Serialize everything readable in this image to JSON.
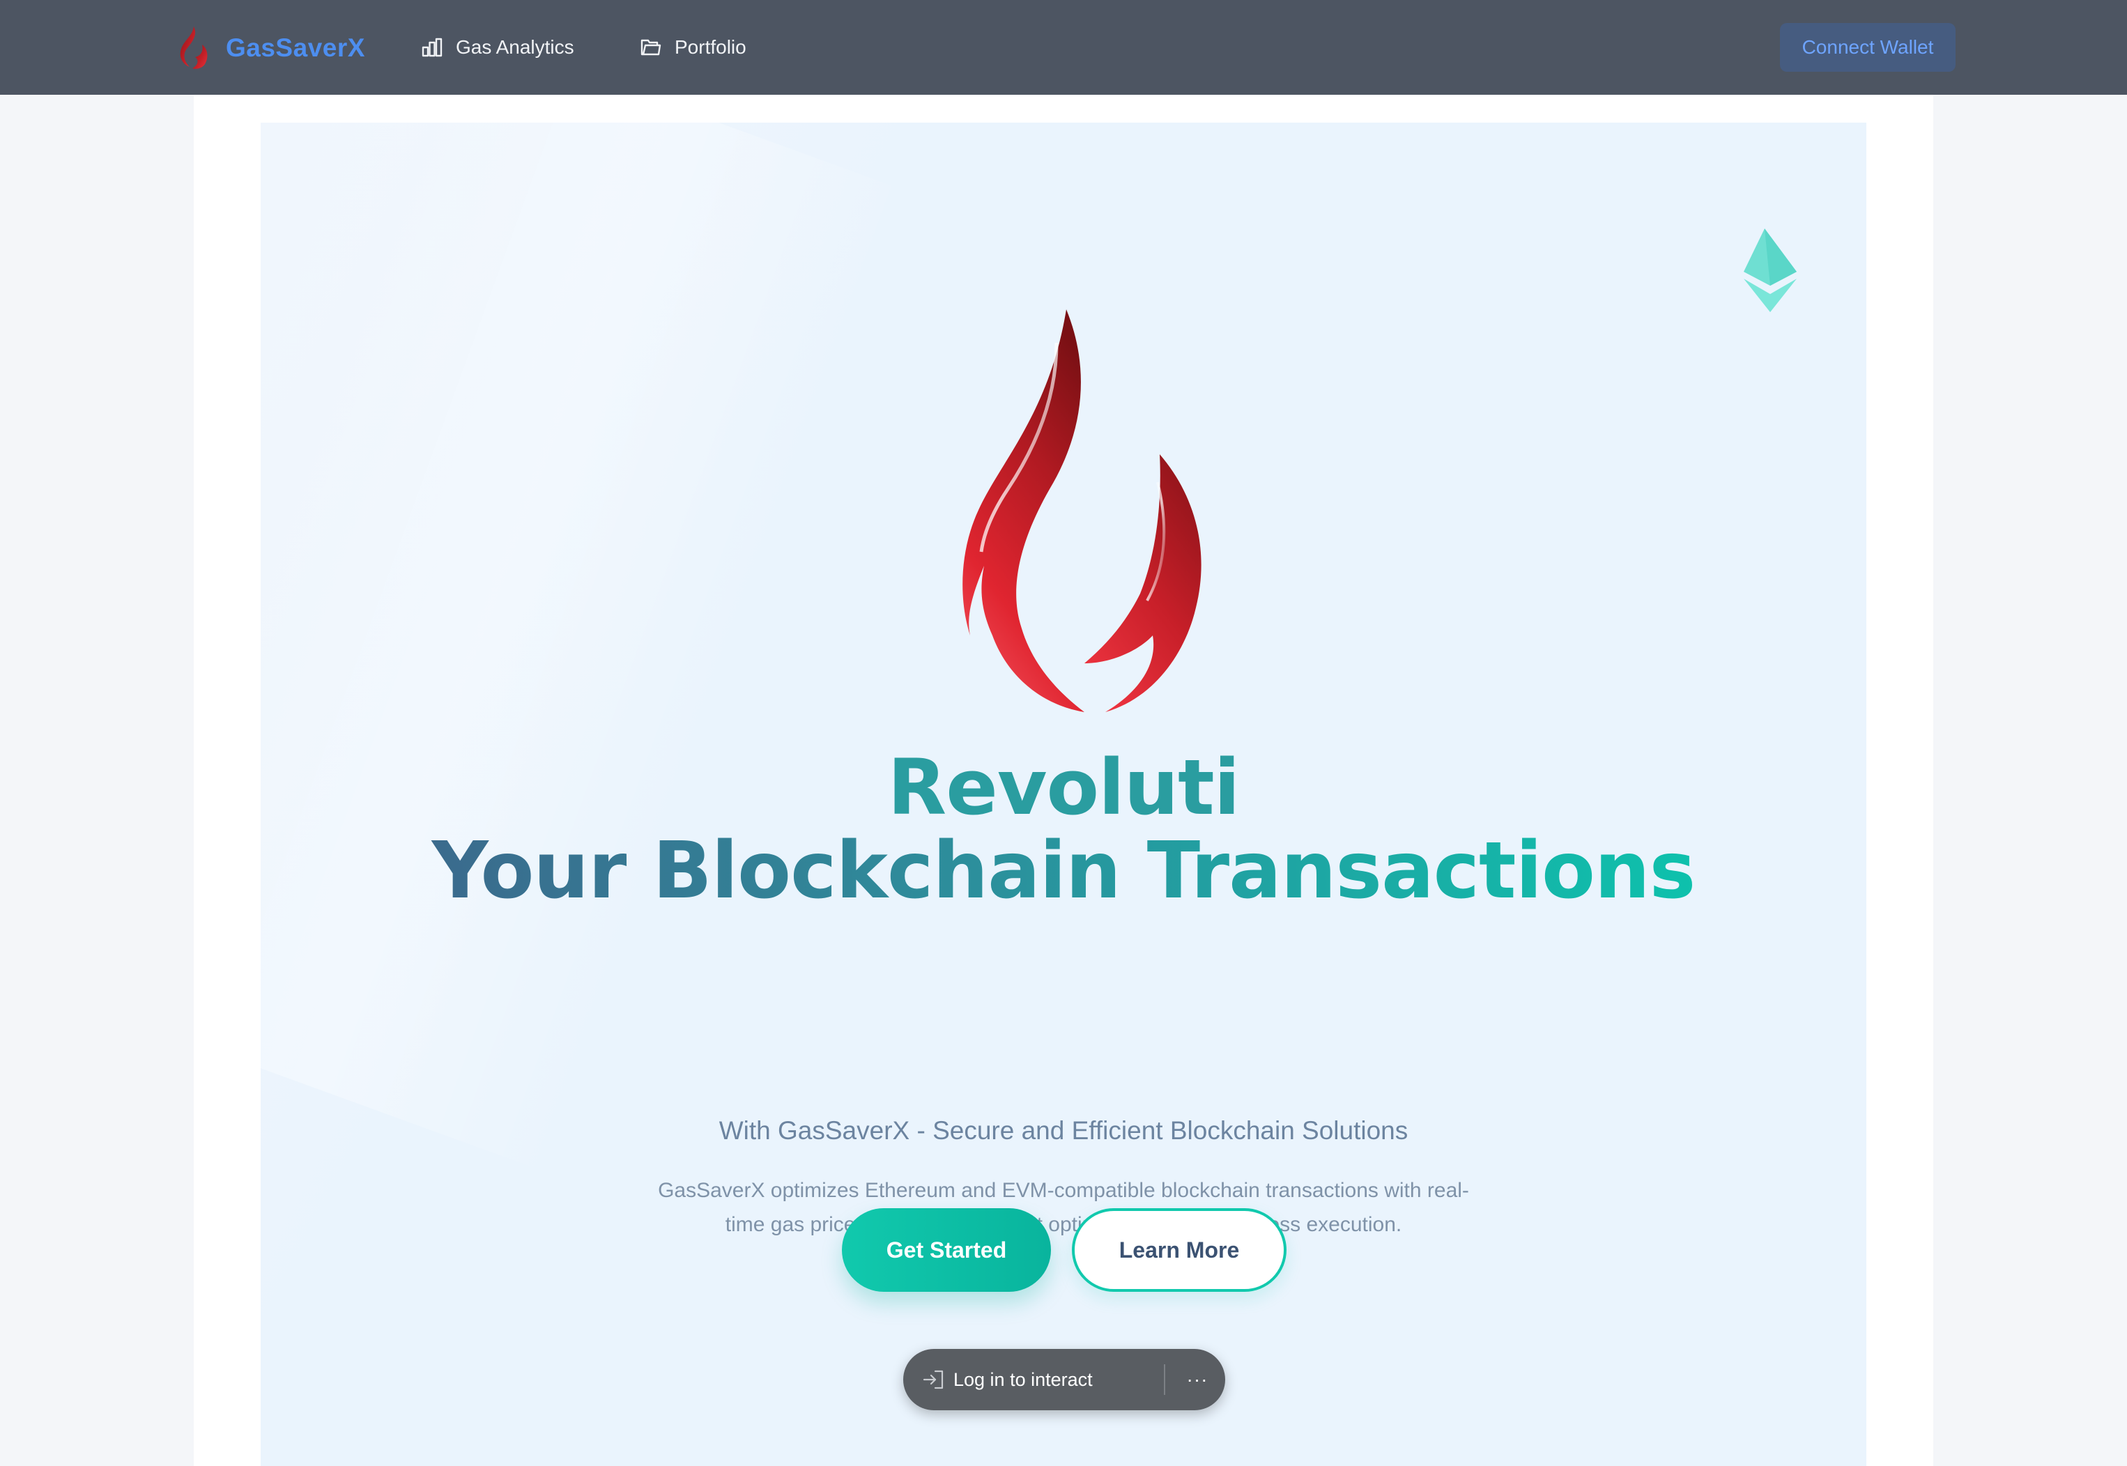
{
  "header": {
    "brand_name": "GasSaverX",
    "brand_logo_icon": "flame-icon",
    "nav": [
      {
        "label": "Gas Analytics",
        "icon": "bar-chart-icon"
      },
      {
        "label": "Portfolio",
        "icon": "folder-icon"
      }
    ],
    "connect_label": "Connect Wallet"
  },
  "hero": {
    "decoration_icon": "ethereum-icon",
    "logo_icon": "flame-icon",
    "title_line1": "Revoluti",
    "title_line2": "Your Blockchain Transactions",
    "subtitle": "With GasSaverX - Secure and Efficient Blockchain Solutions",
    "description": "GasSaverX optimizes Ethereum and EVM-compatible blockchain transactions with real-time gas price analytics, intelligent optimization, and seamless execution.",
    "primary_cta": "Get Started",
    "secondary_cta": "Learn More"
  },
  "login_bar": {
    "label": "Log in to interact",
    "icon": "login-icon",
    "more_label": "···"
  },
  "colors": {
    "navbar_bg": "#4d5562",
    "brand_blue": "#4d8ef0",
    "accent_teal": "#11c9ad",
    "title_dark": "#3f5f88",
    "flame_red": "#d41f2b"
  }
}
